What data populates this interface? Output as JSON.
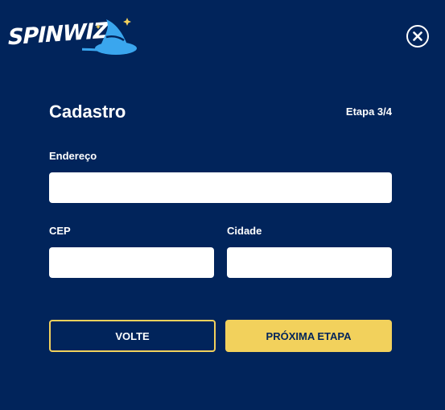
{
  "brand": {
    "logo_text": "SPINWIZ",
    "accent_color": "#f2d15c",
    "background_color": "#01245b",
    "logo_blue": "#3aa6ee"
  },
  "header": {
    "close_icon": "close-icon"
  },
  "form": {
    "title": "Cadastro",
    "step": "Etapa 3/4",
    "fields": {
      "address": {
        "label": "Endereço",
        "value": "",
        "placeholder": ""
      },
      "zip": {
        "label": "CEP",
        "value": "",
        "placeholder": ""
      },
      "city": {
        "label": "Cidade",
        "value": "",
        "placeholder": ""
      }
    },
    "back_label": "VOLTE",
    "next_label": "PRÓXIMA ETAPA"
  }
}
